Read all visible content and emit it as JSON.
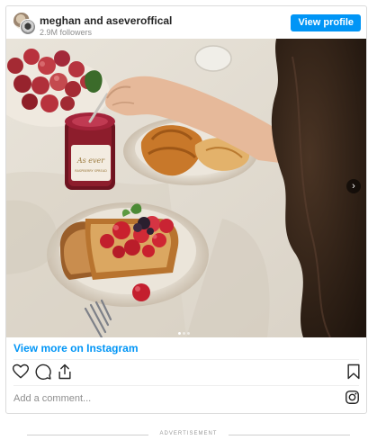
{
  "header": {
    "account_name": "meghan and aseveroffical",
    "followers": "2.9M followers",
    "view_profile_label": "View profile"
  },
  "post": {
    "jar_label_script": "As ever",
    "jar_label_sub": "RASPBERRY SPREAD",
    "carousel": {
      "total": 3,
      "active": 1
    }
  },
  "footer": {
    "view_more_label": "View more on Instagram",
    "comment_placeholder": "Add a comment..."
  },
  "advertisement_label": "ADVERTISEMENT",
  "colors": {
    "accent": "#0095f6",
    "border": "#dbdbdb",
    "muted": "#8e8e8e"
  },
  "icons": {
    "like": "heart-icon",
    "comment": "comment-icon",
    "share": "share-icon",
    "save": "bookmark-icon",
    "instagram": "instagram-logo-icon",
    "next": "chevron-right-icon"
  }
}
